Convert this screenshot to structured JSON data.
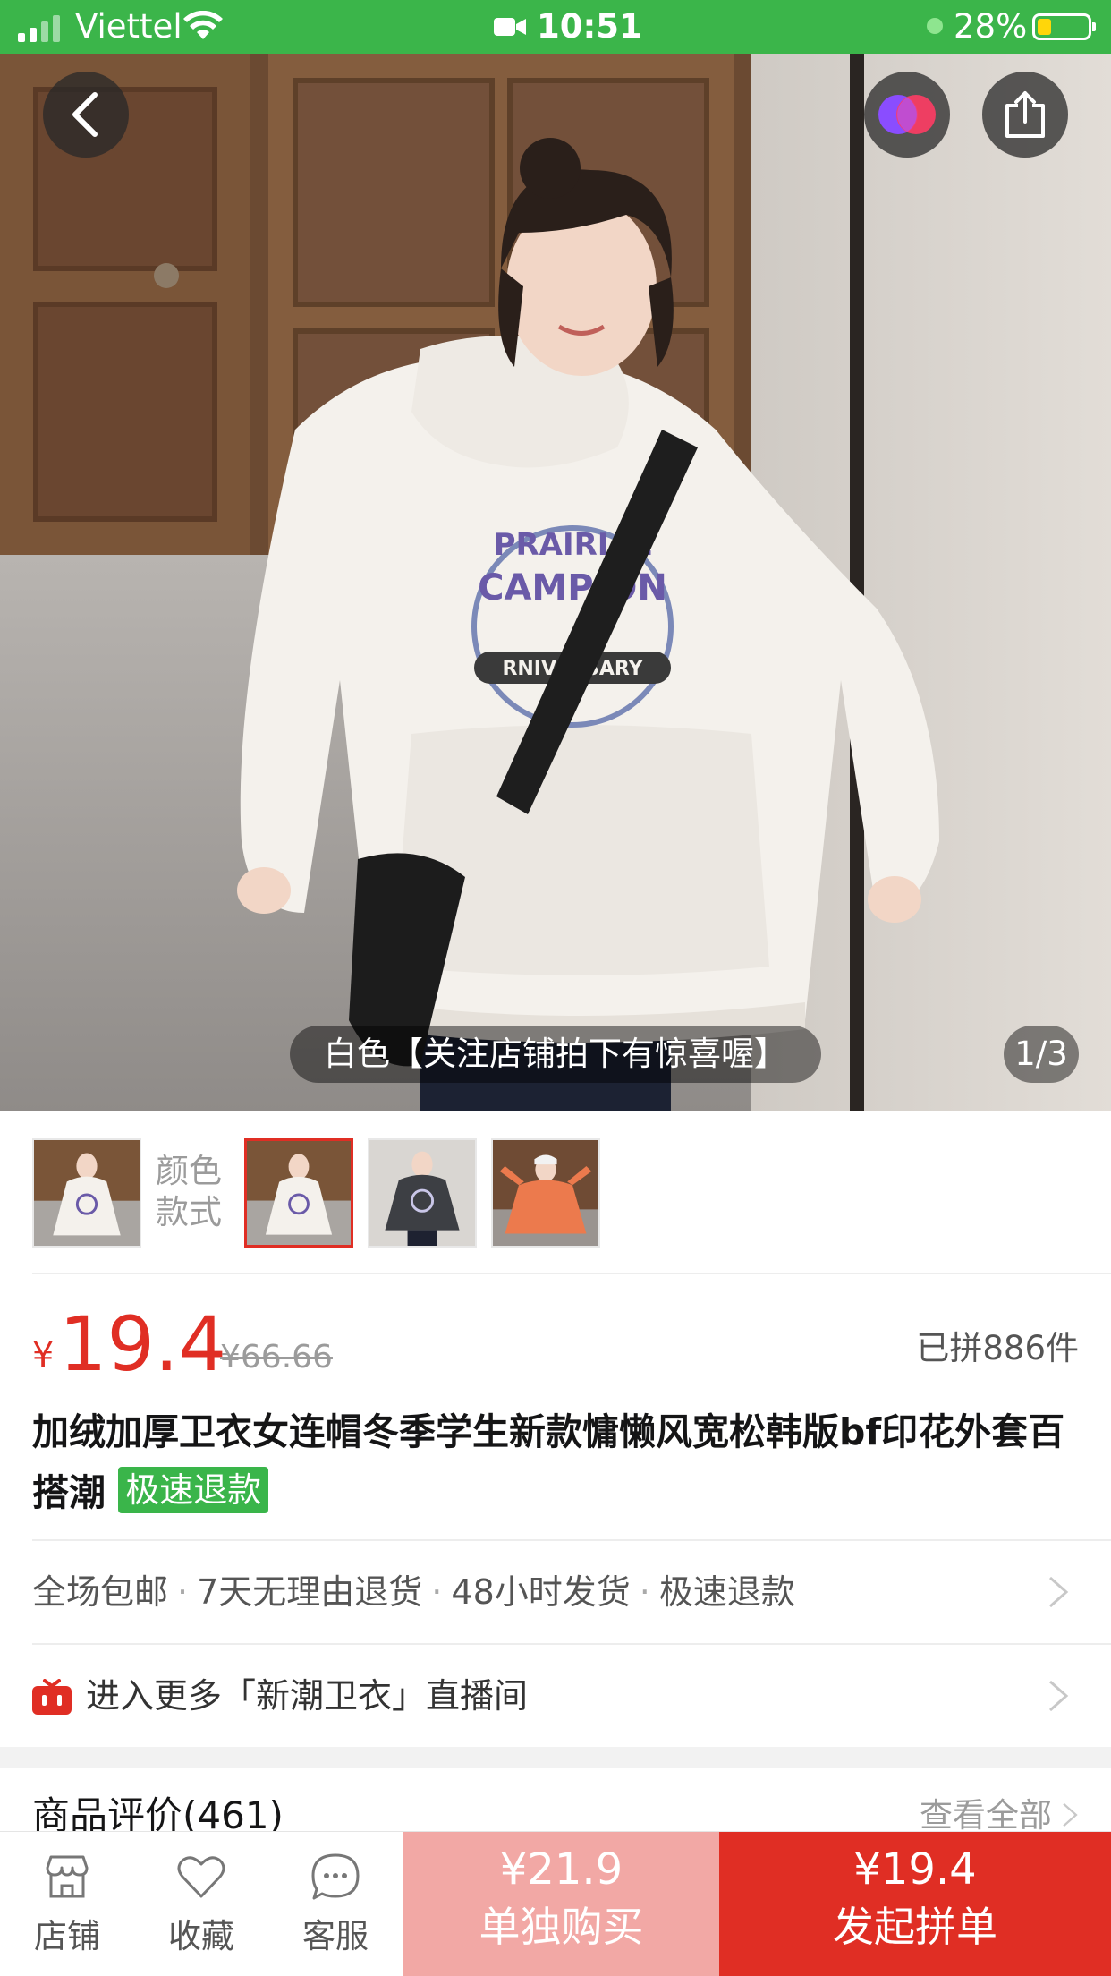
{
  "status_bar": {
    "carrier": "Viettel",
    "time": "10:51",
    "battery_percent": "28%",
    "battery_level": 0.28,
    "icons": [
      "signal-icon",
      "wifi-icon",
      "video-call-icon",
      "battery-icon"
    ]
  },
  "hero": {
    "variant_caption": "白色【关注店铺拍下有惊喜喔】",
    "image_counter": "1/3",
    "controls": [
      "back-icon",
      "app-logo-icon",
      "share-icon"
    ]
  },
  "variants": {
    "label": "颜色款式",
    "items": [
      {
        "name": "white-hoodie",
        "selected": true
      },
      {
        "name": "grey-hoodie",
        "selected": false
      },
      {
        "name": "orange-hoodie",
        "selected": false
      }
    ]
  },
  "price": {
    "currency": "¥",
    "current": "19.4",
    "original": "¥66.66",
    "sold": "已拼886件"
  },
  "product": {
    "title": "加绒加厚卫衣女连帽冬季学生新款慵懒风宽松韩版bf印花外套百搭潮",
    "tag": "极速退款"
  },
  "services": {
    "items": [
      "全场包邮",
      "7天无理由退货",
      "48小时发货",
      "极速退款"
    ],
    "separator": "·"
  },
  "live": {
    "text": "进入更多「新潮卫衣」直播间"
  },
  "reviews": {
    "title": "商品评价(461)",
    "view_all": "查看全部"
  },
  "bottom_bar": {
    "tabs": [
      {
        "label": "店铺",
        "icon": "store-icon"
      },
      {
        "label": "收藏",
        "icon": "heart-icon"
      },
      {
        "label": "客服",
        "icon": "chat-icon"
      }
    ],
    "buy_alone": {
      "price": "¥21.9",
      "label": "单独购买"
    },
    "buy_group": {
      "price": "¥19.4",
      "label": "发起拼单"
    }
  },
  "colors": {
    "status_bar": "#3bb54a",
    "price_red": "#e02e24",
    "tag_green": "#3ab54a",
    "buy_alone_bg": "#f2a8a5"
  }
}
